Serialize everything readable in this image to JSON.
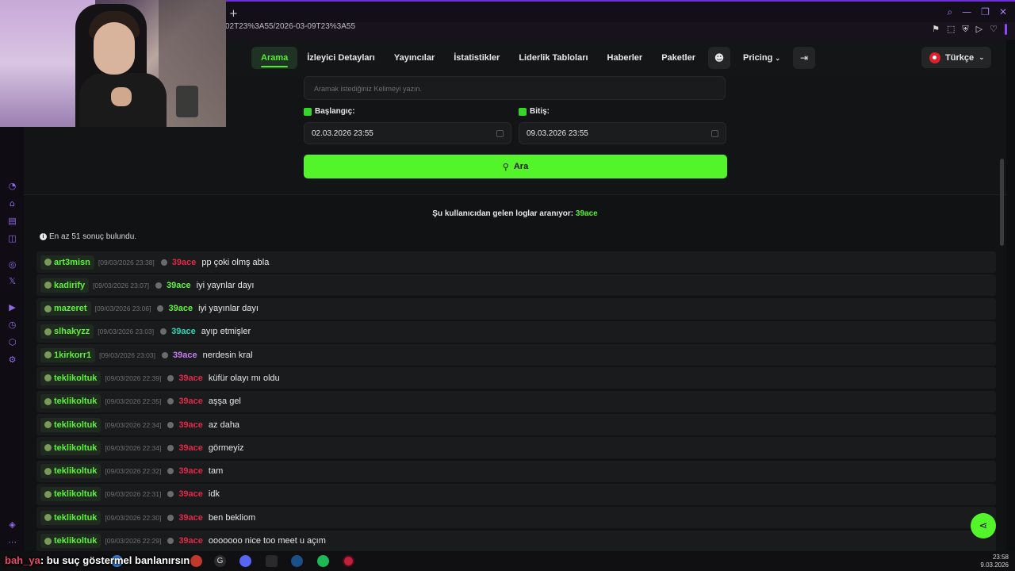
{
  "browser": {
    "url_fragment": "02T23%3A55/2026-03-09T23%3A55",
    "new_tab_label": "+"
  },
  "nav": {
    "items": [
      {
        "label": "Arama",
        "active": true
      },
      {
        "label": "İzleyici Detayları",
        "active": false
      },
      {
        "label": "Yayıncılar",
        "active": false
      },
      {
        "label": "İstatistikler",
        "active": false
      },
      {
        "label": "Liderlik Tabloları",
        "active": false
      },
      {
        "label": "Haberler",
        "active": false
      },
      {
        "label": "Paketler",
        "active": false
      }
    ],
    "pricing_label": "Pricing",
    "language": "Türkçe"
  },
  "search": {
    "keyword_placeholder": "Aramak istediğiniz Kelimeyi yazın.",
    "start_label": "Başlangıç:",
    "start_value": "02.03.2026 23:55",
    "end_label": "Bitiş:",
    "end_value": "09.03.2026 23:55",
    "button_label": "Ara"
  },
  "results": {
    "search_prefix": "Şu kullanıcıdan gelen loglar aranıyor:",
    "search_user": "39ace",
    "count_text": "En az 51 sonuç bulundu.",
    "rows": [
      {
        "user": "art3misn",
        "time": "[09/03/2026 23:38]",
        "target": "39ace",
        "target_color": "#e0284a",
        "message": "pp çoki olmş abla"
      },
      {
        "user": "kadirify",
        "time": "[09/03/2026 23:07]",
        "target": "39ace",
        "target_color": "#5ef23a",
        "message": "iyi yaynlar dayı"
      },
      {
        "user": "mazeret",
        "time": "[09/03/2026 23:06]",
        "target": "39ace",
        "target_color": "#5ef23a",
        "message": "iyi yayınlar dayı"
      },
      {
        "user": "slhakyzz",
        "time": "[09/03/2026 23:03]",
        "target": "39ace",
        "target_color": "#2bd6b4",
        "message": "ayıp etmişler"
      },
      {
        "user": "1kirkorr1",
        "time": "[09/03/2026 23:03]",
        "target": "39ace",
        "target_color": "#c27bf0",
        "message": "nerdesin kral"
      },
      {
        "user": "teklikoltuk",
        "time": "[09/03/2026 22:39]",
        "target": "39ace",
        "target_color": "#e0284a",
        "message": "küfür olayı mı oldu"
      },
      {
        "user": "teklikoltuk",
        "time": "[09/03/2026 22:35]",
        "target": "39ace",
        "target_color": "#e0284a",
        "message": "aşşa gel"
      },
      {
        "user": "teklikoltuk",
        "time": "[09/03/2026 22:34]",
        "target": "39ace",
        "target_color": "#e0284a",
        "message": "az daha"
      },
      {
        "user": "teklikoltuk",
        "time": "[09/03/2026 22:34]",
        "target": "39ace",
        "target_color": "#e0284a",
        "message": "görmeyiz"
      },
      {
        "user": "teklikoltuk",
        "time": "[09/03/2026 22:32]",
        "target": "39ace",
        "target_color": "#e0284a",
        "message": "tam"
      },
      {
        "user": "teklikoltuk",
        "time": "[09/03/2026 22:31]",
        "target": "39ace",
        "target_color": "#e0284a",
        "message": "idk"
      },
      {
        "user": "teklikoltuk",
        "time": "[09/03/2026 22:30]",
        "target": "39ace",
        "target_color": "#e0284a",
        "message": "ben bekliom"
      },
      {
        "user": "teklikoltuk",
        "time": "[09/03/2026 22:29]",
        "target": "39ace",
        "target_color": "#e0284a",
        "message": "ooooooo nice too meet u açım"
      }
    ]
  },
  "taskbar": {
    "time": "23:58",
    "date": "9.03.2026"
  },
  "chat_overlay": {
    "name": "bah_ya",
    "message": ": bu suç göstermel banlanırsın"
  },
  "colors": {
    "accent": "#54f42a",
    "browser_accent": "#6d2fd1",
    "background": "#111213"
  }
}
